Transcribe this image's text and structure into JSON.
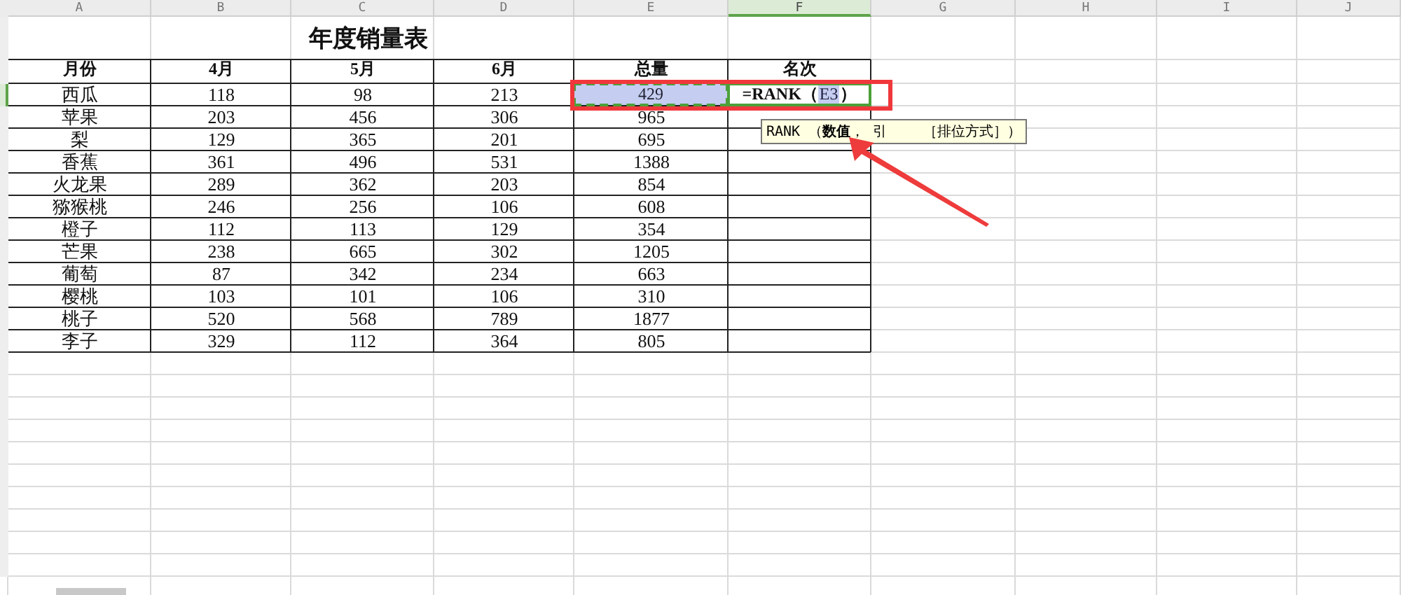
{
  "column_headers": [
    {
      "label": "A",
      "selected": false
    },
    {
      "label": "B",
      "selected": false
    },
    {
      "label": "C",
      "selected": false
    },
    {
      "label": "D",
      "selected": false
    },
    {
      "label": "E",
      "selected": false
    },
    {
      "label": "F",
      "selected": true
    },
    {
      "label": "G",
      "selected": false
    },
    {
      "label": "H",
      "selected": false
    },
    {
      "label": "I",
      "selected": false
    },
    {
      "label": "J",
      "selected": false
    }
  ],
  "sheet": {
    "title": "年度销量表",
    "header": [
      "月份",
      "4月",
      "5月",
      "6月",
      "总量",
      "名次"
    ],
    "rows": [
      {
        "selected": true,
        "reference": true,
        "cells": [
          "西瓜",
          "118",
          "98",
          "213",
          "429"
        ],
        "formula": {
          "prefix": "=RANK（",
          "ref": "E3",
          "suffix": "）"
        }
      },
      {
        "selected": false,
        "reference": false,
        "cells": [
          "苹果",
          "203",
          "456",
          "306",
          "965"
        ]
      },
      {
        "selected": false,
        "reference": false,
        "cells": [
          "梨",
          "129",
          "365",
          "201",
          "695"
        ]
      },
      {
        "selected": false,
        "reference": false,
        "cells": [
          "香蕉",
          "361",
          "496",
          "531",
          "1388"
        ]
      },
      {
        "selected": false,
        "reference": false,
        "cells": [
          "火龙果",
          "289",
          "362",
          "203",
          "854"
        ]
      },
      {
        "selected": false,
        "reference": false,
        "cells": [
          "猕猴桃",
          "246",
          "256",
          "106",
          "608"
        ]
      },
      {
        "selected": false,
        "reference": false,
        "cells": [
          "橙子",
          "112",
          "113",
          "129",
          "354"
        ]
      },
      {
        "selected": false,
        "reference": false,
        "cells": [
          "芒果",
          "238",
          "665",
          "302",
          "1205"
        ]
      },
      {
        "selected": false,
        "reference": false,
        "cells": [
          "葡萄",
          "87",
          "342",
          "234",
          "663"
        ]
      },
      {
        "selected": false,
        "reference": false,
        "cells": [
          "樱桃",
          "103",
          "101",
          "106",
          "310"
        ]
      },
      {
        "selected": false,
        "reference": false,
        "cells": [
          "桃子",
          "520",
          "568",
          "789",
          "1877"
        ]
      },
      {
        "selected": false,
        "reference": false,
        "cells": [
          "李子",
          "329",
          "112",
          "364",
          "805"
        ]
      }
    ]
  },
  "tooltip": {
    "parts": [
      "RANK （**数值**， 引",
      "［排位方式］）"
    ]
  }
}
